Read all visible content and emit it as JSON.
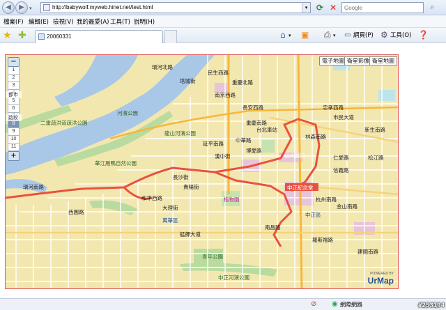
{
  "browser": {
    "url": "http://babywolf.myweb.hinet.net/test.html",
    "search_placeholder": "Google",
    "menu": [
      "檔案(F)",
      "編輯(E)",
      "檢視(V)",
      "我的最愛(A)",
      "工具(T)",
      "說明(H)"
    ],
    "tab_title": "20060331",
    "commands": {
      "page": "網頁(P)",
      "tools": "工具(O)"
    },
    "status_zone": "網際網路",
    "colors": {
      "accent": "#2b5797",
      "map_border": "#e25a5a",
      "route": "#e8523f"
    }
  },
  "map": {
    "zoom_levels": [
      "1",
      "2",
      "3",
      "4",
      "5",
      "6",
      "7",
      "8",
      "9",
      "10",
      "11"
    ],
    "zoom_active": "8",
    "zoom_labels": {
      "city": "都市",
      "street": "路段"
    },
    "map_types": [
      "電子地圖",
      "衛星影像",
      "衛星地圖"
    ],
    "logo": "UrMap",
    "logo_sub": "POWERED BY",
    "labels": [
      {
        "text": "華江雁鴨自然公園"
      },
      {
        "text": "河濱公園"
      },
      {
        "text": "二重疏洪道疏洪公園"
      },
      {
        "text": "龍山河濱公園"
      },
      {
        "text": "台大醫院"
      },
      {
        "text": "中正紀念堂"
      },
      {
        "text": "植物園"
      },
      {
        "text": "中正區"
      },
      {
        "text": "萬華區"
      },
      {
        "text": "青年公園"
      },
      {
        "text": "中正河濱公園"
      },
      {
        "text": "環河南路"
      },
      {
        "text": "中華路"
      },
      {
        "text": "忠孝西路"
      },
      {
        "text": "仁愛路"
      },
      {
        "text": "信義路"
      },
      {
        "text": "和平西路"
      },
      {
        "text": "西園路"
      },
      {
        "text": "大理街"
      },
      {
        "text": "民生西路"
      },
      {
        "text": "台北車站"
      },
      {
        "text": "重慶南路"
      },
      {
        "text": "延平南路"
      },
      {
        "text": "市民大道"
      },
      {
        "text": "新生南路"
      },
      {
        "text": "羅斯福路"
      },
      {
        "text": "南昌路"
      },
      {
        "text": "艋舺大道"
      },
      {
        "text": "長沙街"
      },
      {
        "text": "貴陽街"
      },
      {
        "text": "漢中街"
      },
      {
        "text": "博愛路"
      },
      {
        "text": "林森南路"
      },
      {
        "text": "杭州南路"
      },
      {
        "text": "金山南路"
      },
      {
        "text": "松江路"
      },
      {
        "text": "建國南路"
      },
      {
        "text": "長安西路"
      },
      {
        "text": "南京西路"
      },
      {
        "text": "重慶北路"
      },
      {
        "text": "塔城街"
      },
      {
        "text": "環河北路"
      }
    ]
  },
  "watermark": "#253194"
}
